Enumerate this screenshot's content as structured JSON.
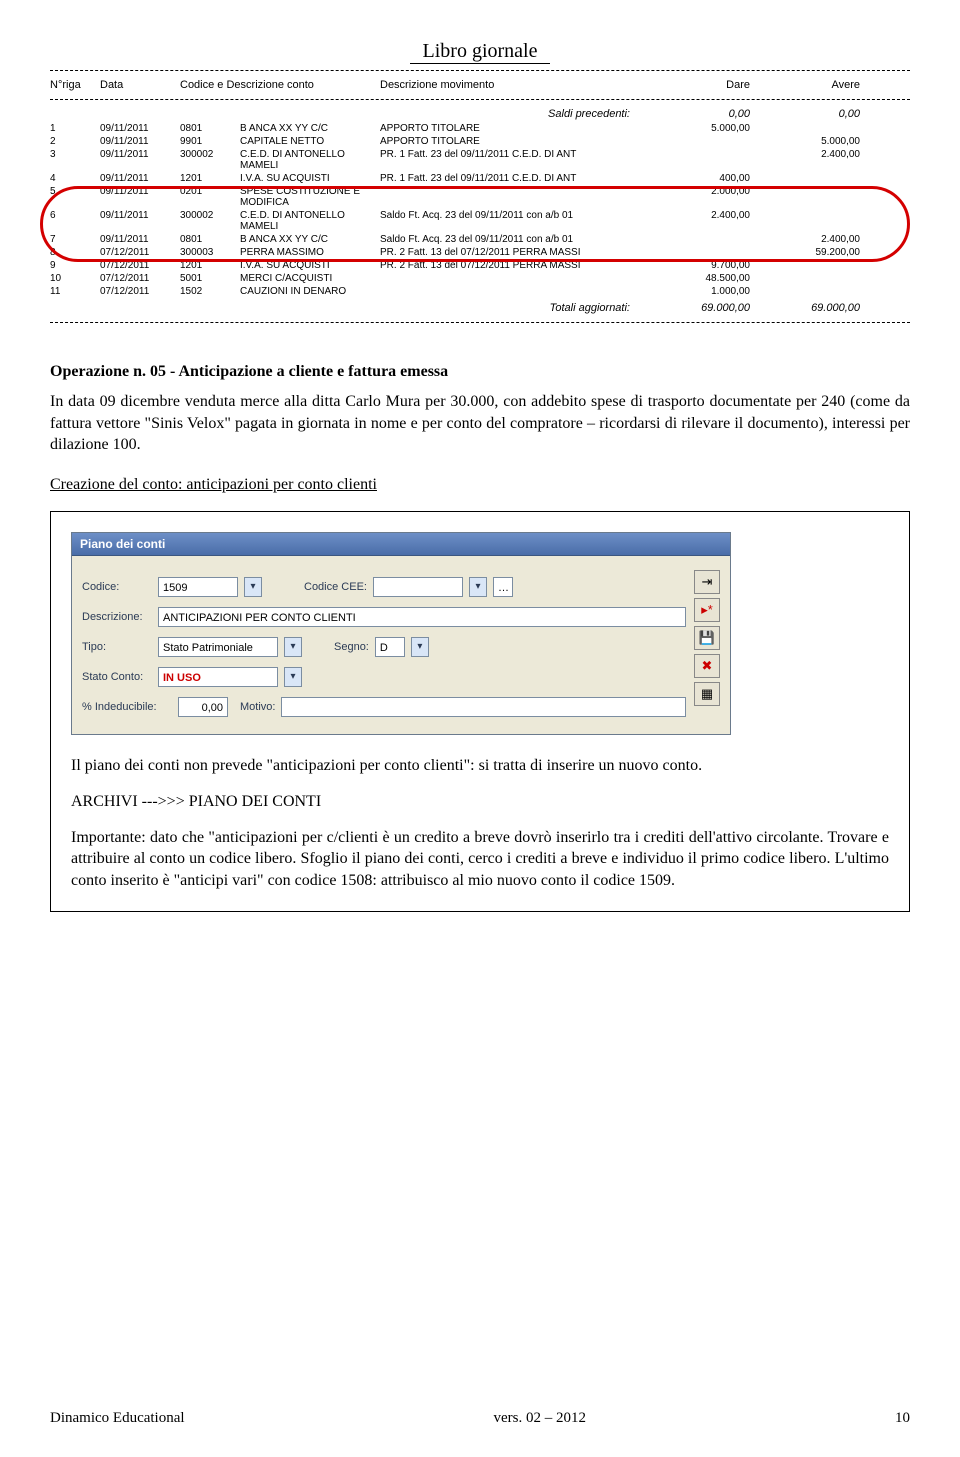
{
  "report": {
    "title": "Libro giornale",
    "columns": {
      "riga": "N°riga",
      "data": "Data",
      "codedesc": "Codice e Descrizione conto",
      "descrmov": "Descrizione movimento",
      "dare": "Dare",
      "avere": "Avere"
    },
    "saldi_label": "Saldi precedenti:",
    "saldi_dare": "0,00",
    "saldi_avere": "0,00",
    "rows": [
      {
        "n": "1",
        "data": "09/11/2011",
        "cod": "0801",
        "desc": "B ANCA XX YY C/C",
        "mov": "APPORTO TITOLARE",
        "dare": "5.000,00",
        "avere": ""
      },
      {
        "n": "2",
        "data": "09/11/2011",
        "cod": "9901",
        "desc": "CAPITALE NETTO",
        "mov": "APPORTO TITOLARE",
        "dare": "",
        "avere": "5.000,00"
      },
      {
        "n": "3",
        "data": "09/11/2011",
        "cod": "300002",
        "desc": "C.E.D. DI ANTONELLO MAMELI",
        "mov": "PR. 1 Fatt. 23 del 09/11/2011 C.E.D. DI ANT",
        "dare": "",
        "avere": "2.400,00"
      },
      {
        "n": "4",
        "data": "09/11/2011",
        "cod": "1201",
        "desc": "I.V.A. SU ACQUISTI",
        "mov": "PR. 1 Fatt. 23 del 09/11/2011 C.E.D. DI ANT",
        "dare": "400,00",
        "avere": ""
      },
      {
        "n": "5",
        "data": "09/11/2011",
        "cod": "0201",
        "desc": "SPESE COSTITUZIONE E MODIFICA",
        "mov": "",
        "dare": "2.000,00",
        "avere": ""
      },
      {
        "n": "6",
        "data": "09/11/2011",
        "cod": "300002",
        "desc": "C.E.D. DI ANTONELLO MAMELI",
        "mov": "Saldo Ft. Acq. 23 del 09/11/2011 con a/b 01",
        "dare": "2.400,00",
        "avere": ""
      },
      {
        "n": "7",
        "data": "09/11/2011",
        "cod": "0801",
        "desc": "B ANCA XX YY C/C",
        "mov": "Saldo Ft. Acq. 23 del 09/11/2011 con a/b 01",
        "dare": "",
        "avere": "2.400,00"
      },
      {
        "n": "8",
        "data": "07/12/2011",
        "cod": "300003",
        "desc": "PERRA MASSIMO",
        "mov": "PR. 2 Fatt. 13 del 07/12/2011 PERRA MASSI",
        "dare": "",
        "avere": "59.200,00"
      },
      {
        "n": "9",
        "data": "07/12/2011",
        "cod": "1201",
        "desc": "I.V.A. SU ACQUISTI",
        "mov": "PR. 2 Fatt. 13 del 07/12/2011 PERRA MASSI",
        "dare": "9.700,00",
        "avere": ""
      },
      {
        "n": "10",
        "data": "07/12/2011",
        "cod": "5001",
        "desc": "MERCI C/ACQUISTI",
        "mov": "",
        "dare": "48.500,00",
        "avere": ""
      },
      {
        "n": "11",
        "data": "07/12/2011",
        "cod": "1502",
        "desc": "CAUZIONI IN DENARO",
        "mov": "",
        "dare": "1.000,00",
        "avere": ""
      }
    ],
    "totali_label": "Totali aggiornati:",
    "totali_dare": "69.000,00",
    "totali_avere": "69.000,00"
  },
  "op_heading": "Operazione n. 05 - Anticipazione a cliente e fattura emessa",
  "para1": "In data 09 dicembre venduta merce alla ditta Carlo Mura per 30.000, con addebito spese di trasporto documentate per 240 (come da fattura vettore \"Sinis Velox\" pagata in giornata in nome e per conto del compratore – ricordarsi di rilevare il documento), interessi per dilazione 100.",
  "creazione_label": "Creazione del conto: anticipazioni per conto clienti",
  "form": {
    "title": "Piano dei conti",
    "labels": {
      "codice": "Codice:",
      "codice_cee": "Codice CEE:",
      "descrizione": "Descrizione:",
      "tipo": "Tipo:",
      "segno": "Segno:",
      "stato": "Stato Conto:",
      "ind": "% Indeducibile:",
      "motivo": "Motivo:"
    },
    "values": {
      "codice": "1509",
      "codice_cee": "",
      "descrizione": "ANTICIPAZIONI PER CONTO CLIENTI",
      "tipo": "Stato Patrimoniale",
      "segno": "D",
      "stato": "IN USO",
      "ind": "0,00",
      "motivo": ""
    }
  },
  "para2": "Il piano dei conti non prevede \"anticipazioni per conto clienti\": si tratta di inserire un nuovo conto.",
  "archivi": "ARCHIVI   --->>> PIANO DEI CONTI",
  "para3a": "Importante:  dato che \"anticipazioni per c/clienti è un credito a breve dovrò inserirlo tra i crediti dell'attivo circolante. Trovare e attribuire al conto un codice libero. Sfoglio il piano dei conti, cerco i crediti a breve e individuo il primo codice libero. L'ultimo conto inserito è \"anticipi vari\" con codice 1508: attribuisco al mio nuovo conto il codice 1509.",
  "footer": {
    "l": "Dinamico Educational",
    "c": "vers. 02 – 2012",
    "r": "10"
  }
}
